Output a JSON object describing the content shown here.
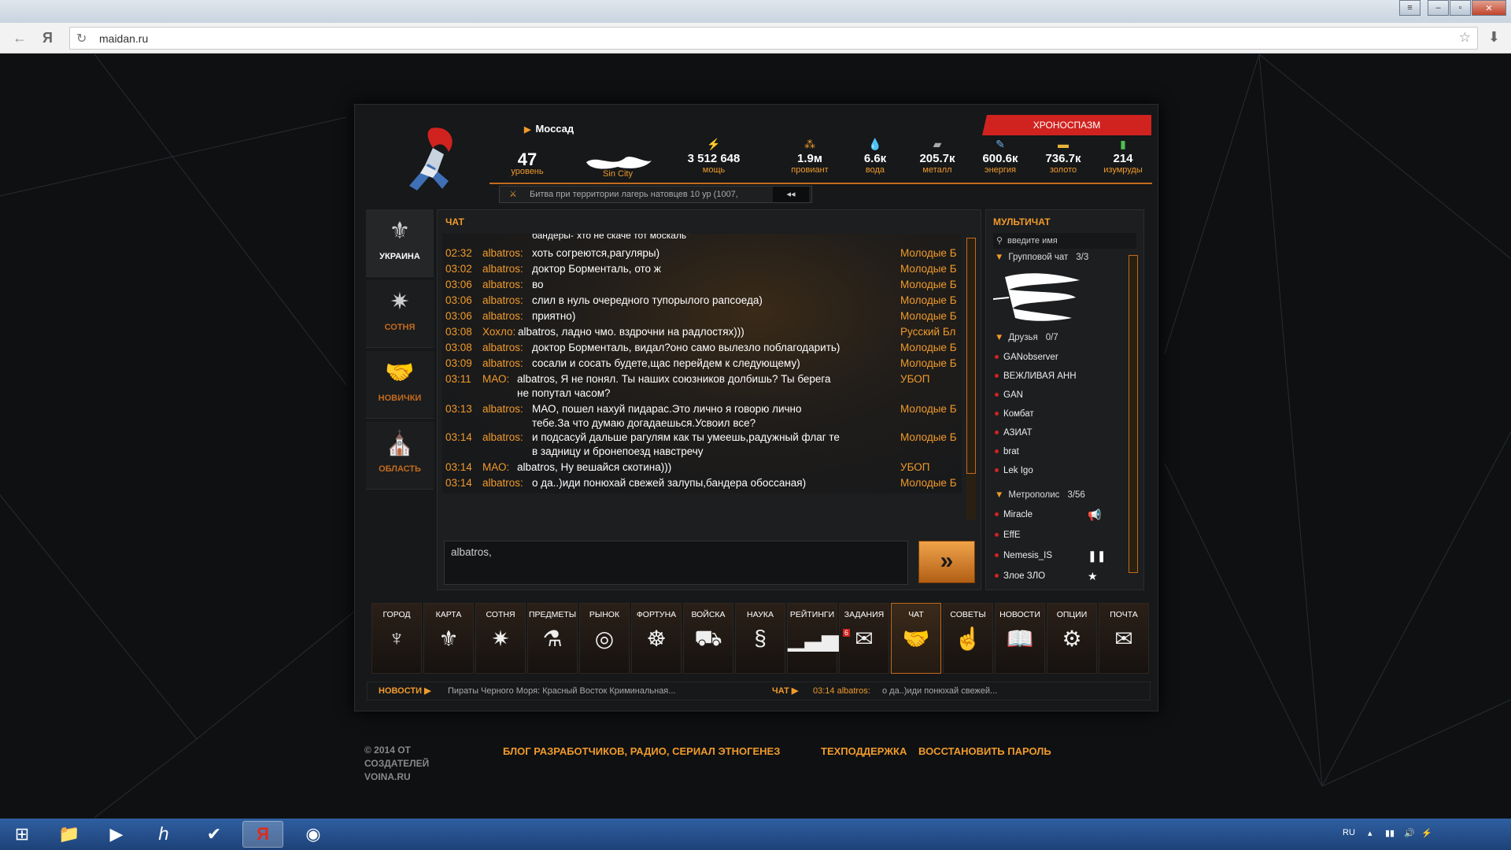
{
  "browser": {
    "url": "maidan.ru",
    "yandex_glyph": "Я"
  },
  "header": {
    "location": "Моссад",
    "chrono_button": "ХРОНОСПАЗМ",
    "stats": [
      {
        "value": "47",
        "label": "уровень",
        "icon": "level"
      },
      {
        "value": "",
        "label": "Sin City",
        "icon": "clan-emblem"
      },
      {
        "value": "3 512 648",
        "label": "мощь",
        "icon": "lightning-icon"
      },
      {
        "value": "1.9м",
        "label": "провиант",
        "icon": "wheat-icon"
      },
      {
        "value": "6.6к",
        "label": "вода",
        "icon": "water-icon"
      },
      {
        "value": "205.7к",
        "label": "металл",
        "icon": "metal-icon"
      },
      {
        "value": "600.6к",
        "label": "энергия",
        "icon": "energy-icon"
      },
      {
        "value": "736.7к",
        "label": "золото",
        "icon": "gold-icon"
      },
      {
        "value": "214",
        "label": "изумруды",
        "icon": "emerald-icon"
      }
    ],
    "battle_text": "Битва при территории лагерь натовцев 10 ур (1007,",
    "battle_button": "◂◂"
  },
  "sidenav": [
    {
      "label": "УКРАИНА",
      "icon": "trident-icon"
    },
    {
      "label": "СОТНЯ",
      "icon": "mace-icon"
    },
    {
      "label": "НОВИЧКИ",
      "icon": "handshake-icon"
    },
    {
      "label": "ОБЛАСТЬ",
      "icon": "city-icon"
    }
  ],
  "chat": {
    "title": "ЧАТ",
    "partial_line": "бандеры-\"хто не скаче тот москаль\"",
    "messages": [
      {
        "time": "02:32",
        "name": "albatros:",
        "text": "хоть согреются,рагуляры)",
        "group": "Молодые Б"
      },
      {
        "time": "03:02",
        "name": "albatros:",
        "text": "доктор Борменталь, ото ж",
        "group": "Молодые Б"
      },
      {
        "time": "03:06",
        "name": "albatros:",
        "text": "во",
        "group": "Молодые Б"
      },
      {
        "time": "03:06",
        "name": "albatros:",
        "text": "слил в нуль очередного тупорылого рапсоеда)",
        "group": "Молодые Б"
      },
      {
        "time": "03:06",
        "name": "albatros:",
        "text": "приятно)",
        "group": "Молодые Б"
      },
      {
        "time": "03:08",
        "name": "Хохло:",
        "text": "albatros,  ладно чмо. вздрочни на радлостях)))",
        "group": "Русский Бл"
      },
      {
        "time": "03:08",
        "name": "albatros:",
        "text": "доктор Борменталь, видал?оно само вылезло поблагодарить)",
        "group": "Молодые Б"
      },
      {
        "time": "03:09",
        "name": "albatros:",
        "text": "сосали и сосать будете,щас перейдем к следующему)",
        "group": "Молодые Б"
      },
      {
        "time": "03:11",
        "name": "МАО:",
        "text": "albatros, Я не понял. Ты наших союзников долбишь? Ты берега\nне попутал часом?",
        "group": "УБОП"
      },
      {
        "time": "03:13",
        "name": "albatros:",
        "text": "МАО, пошел нахуй пидарас.Это лично я говорю лично\nтебе.За что думаю догадаешься.Усвоил все?",
        "group": "Молодые Б"
      },
      {
        "time": "03:14",
        "name": "albatros:",
        "text": "и подсасуй дальше рагулям как ты умеешь,радужный флаг те\nв задницу и бронепоезд навстречу",
        "group": "Молодые Б"
      },
      {
        "time": "03:14",
        "name": "МАО:",
        "text": "albatros, Ну вешайся скотина)))",
        "group": "УБОП"
      },
      {
        "time": "03:14",
        "name": "albatros:",
        "text": "о да..)иди понюхай свежей залупы,бандера обоссаная)",
        "group": "Молодые Б"
      }
    ],
    "input_value": "albatros,",
    "send_icon": "double-chevron-icon"
  },
  "multichat": {
    "title": "МУЛЬТИЧАТ",
    "search_placeholder": "введите имя",
    "groups": [
      {
        "name": "Групповой чат",
        "count": "3/3"
      },
      {
        "name": "Друзья",
        "count": "0/7"
      },
      {
        "name": "Метрополис",
        "count": "3/56"
      }
    ],
    "friends": [
      "GANobserver",
      "ВЕЖЛИВАЯ АНН",
      "GAN",
      "Комбат",
      "АЗИАТ",
      "brat",
      "Lek Igo"
    ],
    "metropolis": [
      {
        "name": "Miracle",
        "icon": "megaphone-icon"
      },
      {
        "name": "EffE",
        "icon": ""
      },
      {
        "name": "Nemesis_IS",
        "icon": "pause-icon"
      },
      {
        "name": "Злое ЗЛО",
        "icon": "star-icon"
      }
    ]
  },
  "menu": [
    {
      "label": "ГОРОД",
      "icon": "torch-icon"
    },
    {
      "label": "КАРТА",
      "icon": "trident-icon"
    },
    {
      "label": "СОТНЯ",
      "icon": "mace-icon"
    },
    {
      "label": "ПРЕДМЕТЫ",
      "icon": "items-icon"
    },
    {
      "label": "РЫНОК",
      "icon": "coins-icon"
    },
    {
      "label": "ФОРТУНА",
      "icon": "wheel-icon"
    },
    {
      "label": "ВОЙСКА",
      "icon": "tank-icon"
    },
    {
      "label": "НАУКА",
      "icon": "dna-icon"
    },
    {
      "label": "РЕЙТИНГИ",
      "icon": "bars-icon"
    },
    {
      "label": "ЗАДАНИЯ",
      "icon": "scroll-icon",
      "badge": "6"
    },
    {
      "label": "ЧАТ",
      "icon": "handshake-icon"
    },
    {
      "label": "СОВЕТЫ",
      "icon": "hand-icon"
    },
    {
      "label": "НОВОСТИ",
      "icon": "book-icon"
    },
    {
      "label": "ОПЦИИ",
      "icon": "gears-icon"
    },
    {
      "label": "ПОЧТА",
      "icon": "mail-icon"
    }
  ],
  "ticker": {
    "news_label": "НОВОСТИ",
    "news_text": "Пираты Черного Моря: Красный Восток Криминальная...",
    "chat_label": "ЧАТ",
    "chat_time": "03:14 albatros:",
    "chat_text": "о да..)иди понюхай свежей..."
  },
  "footer": {
    "copyright_1": "© 2014 ОТ",
    "copyright_2": "СОЗДАТЕЛЕЙ",
    "copyright_3": "VOINA.RU",
    "link_blog": "БЛОГ РАЗРАБОТЧИКОВ, РАДИО, СЕРИАЛ ЭТНОГЕНЕЗ",
    "link_support": "ТЕХПОДДЕРЖКА",
    "link_restore": "ВОССТАНОВИТЬ ПАРОЛЬ"
  },
  "taskbar": {
    "lang": "RU"
  },
  "colors": {
    "accent_orange": "#f09a2b",
    "red": "#d0231f",
    "taskbar": "#1d4279"
  }
}
